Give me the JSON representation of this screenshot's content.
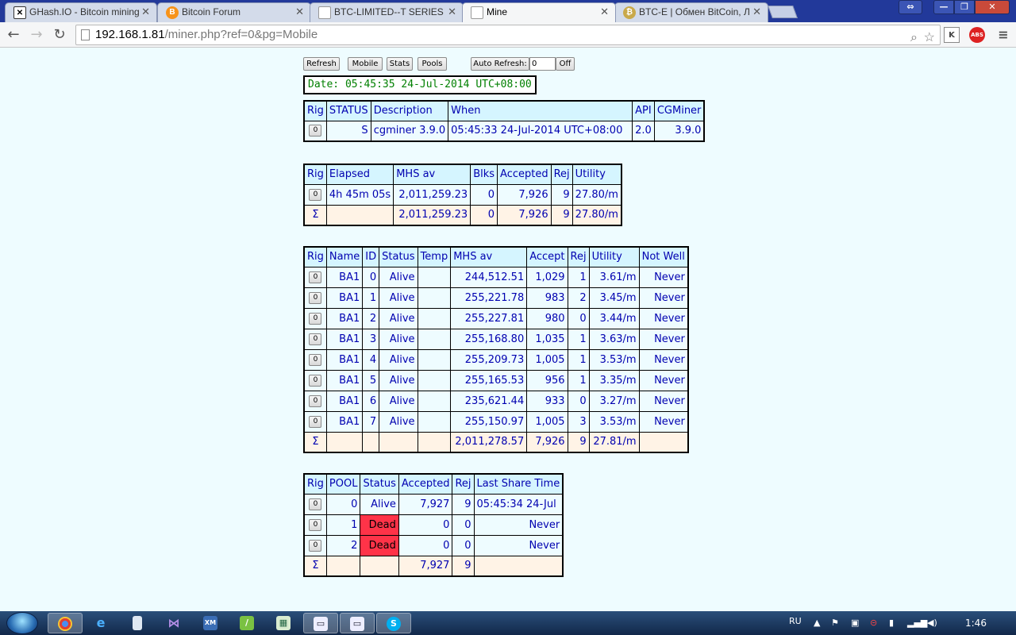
{
  "browser": {
    "tabs": [
      {
        "title": "GHash.IO - Bitcoin mining",
        "icon": "ghash-icon"
      },
      {
        "title": "Bitcoin Forum",
        "icon": "bitcoin-icon"
      },
      {
        "title": "BTC-LIMITED--T SERIES",
        "icon": "page-icon"
      },
      {
        "title": "Mine",
        "icon": "page-icon",
        "active": true
      },
      {
        "title": "BTC-E | Обмен BitCoin, Л",
        "icon": "btce-icon"
      }
    ],
    "url_host": "192.168.1.81",
    "url_path": "/miner.php?ref=0&pg=Mobile",
    "ext_k": "K",
    "ext_abs": "ABS"
  },
  "controls": {
    "refresh": "Refresh",
    "mobile": "Mobile",
    "stats": "Stats",
    "pools": "Pools",
    "auto_refresh": "Auto Refresh:",
    "auto_refresh_value": "0",
    "off": "Off"
  },
  "date_line": "Date: 05:45:35 24-Jul-2014 UTC+08:00",
  "rig_button_label": "0",
  "sum_symbol": "Σ",
  "summary_table": {
    "headers": [
      "Rig",
      "STATUS",
      "Description",
      "When",
      "API",
      "CGMiner"
    ],
    "row": {
      "status": "S",
      "description": "cgminer 3.9.0",
      "when": "05:45:33 24-Jul-2014 UTC+08:00",
      "api": "2.0",
      "cgminer": "3.9.0"
    }
  },
  "stats_table": {
    "headers": [
      "Rig",
      "Elapsed",
      "MHS av",
      "Blks",
      "Accepted",
      "Rej",
      "Utility"
    ],
    "row": {
      "elapsed": "4h 45m 05s",
      "mhs_av": "2,011,259.23",
      "blks": "0",
      "accepted": "7,926",
      "rej": "9",
      "utility": "27.80/m"
    },
    "total": {
      "elapsed": "",
      "mhs_av": "2,011,259.23",
      "blks": "0",
      "accepted": "7,926",
      "rej": "9",
      "utility": "27.80/m"
    }
  },
  "devices_table": {
    "headers": [
      "Rig",
      "Name",
      "ID",
      "Status",
      "Temp",
      "MHS av",
      "Accept",
      "Rej",
      "Utility",
      "Not Well"
    ],
    "rows": [
      {
        "name": "BA1",
        "id": "0",
        "status": "Alive",
        "temp": "",
        "mhs": "244,512.51",
        "accept": "1,029",
        "rej": "1",
        "utility": "3.61/m",
        "notwell": "Never"
      },
      {
        "name": "BA1",
        "id": "1",
        "status": "Alive",
        "temp": "",
        "mhs": "255,221.78",
        "accept": "983",
        "rej": "2",
        "utility": "3.45/m",
        "notwell": "Never"
      },
      {
        "name": "BA1",
        "id": "2",
        "status": "Alive",
        "temp": "",
        "mhs": "255,227.81",
        "accept": "980",
        "rej": "0",
        "utility": "3.44/m",
        "notwell": "Never"
      },
      {
        "name": "BA1",
        "id": "3",
        "status": "Alive",
        "temp": "",
        "mhs": "255,168.80",
        "accept": "1,035",
        "rej": "1",
        "utility": "3.63/m",
        "notwell": "Never"
      },
      {
        "name": "BA1",
        "id": "4",
        "status": "Alive",
        "temp": "",
        "mhs": "255,209.73",
        "accept": "1,005",
        "rej": "1",
        "utility": "3.53/m",
        "notwell": "Never"
      },
      {
        "name": "BA1",
        "id": "5",
        "status": "Alive",
        "temp": "",
        "mhs": "255,165.53",
        "accept": "956",
        "rej": "1",
        "utility": "3.35/m",
        "notwell": "Never"
      },
      {
        "name": "BA1",
        "id": "6",
        "status": "Alive",
        "temp": "",
        "mhs": "235,621.44",
        "accept": "933",
        "rej": "0",
        "utility": "3.27/m",
        "notwell": "Never"
      },
      {
        "name": "BA1",
        "id": "7",
        "status": "Alive",
        "temp": "",
        "mhs": "255,150.97",
        "accept": "1,005",
        "rej": "3",
        "utility": "3.53/m",
        "notwell": "Never"
      }
    ],
    "total": {
      "mhs": "2,011,278.57",
      "accept": "7,926",
      "rej": "9",
      "utility": "27.81/m"
    }
  },
  "pools_table": {
    "headers": [
      "Rig",
      "POOL",
      "Status",
      "Accepted",
      "Rej",
      "Last Share Time"
    ],
    "rows": [
      {
        "pool": "0",
        "status": "Alive",
        "accepted": "7,927",
        "rej": "9",
        "last": "05:45:34 24-Jul",
        "dead": false
      },
      {
        "pool": "1",
        "status": "Dead",
        "accepted": "0",
        "rej": "0",
        "last": "Never",
        "dead": true
      },
      {
        "pool": "2",
        "status": "Dead",
        "accepted": "0",
        "rej": "0",
        "last": "Never",
        "dead": true
      }
    ],
    "total": {
      "accepted": "7,927",
      "rej": "9"
    }
  },
  "colors": {
    "dead": "#ff3348",
    "header_bg": "#d5f5ff",
    "sum_bg": "#fff3e6",
    "text": "#0000b0",
    "date_text": "#008000"
  },
  "taskbar": {
    "language": "RU",
    "clock": "1:46",
    "apps": [
      "chrome-icon",
      "ie-icon",
      "notepad-icon",
      "visual-studio-icon",
      "xml-icon",
      "pen-icon",
      "image-icon",
      "window-icon",
      "window-icon",
      "skype-icon"
    ]
  }
}
